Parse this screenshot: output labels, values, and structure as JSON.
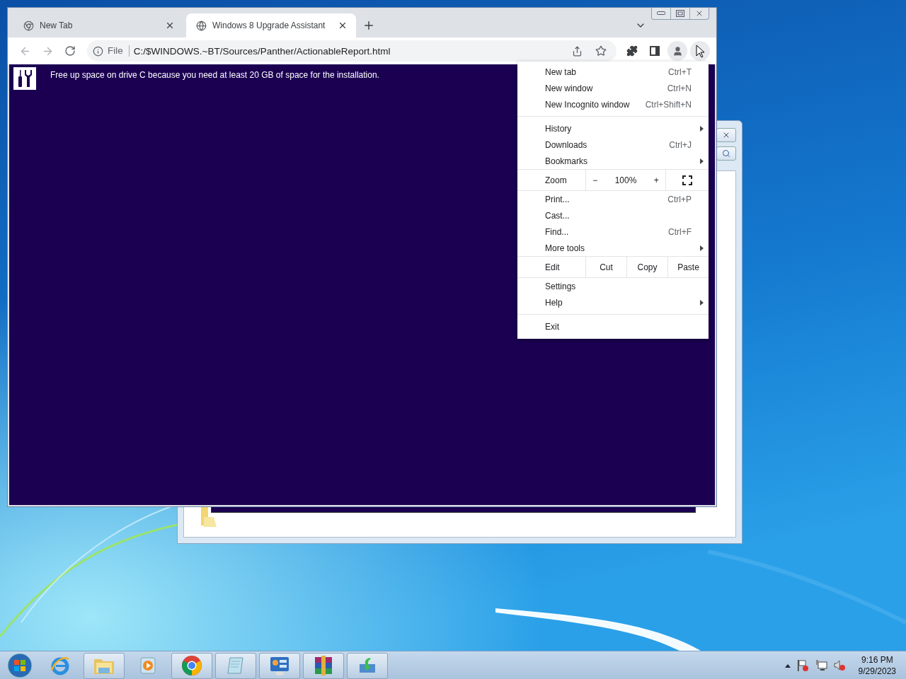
{
  "browser": {
    "tabs": [
      {
        "title": "New Tab",
        "kind": "chrome",
        "selected": false
      },
      {
        "title": "Windows 8 Upgrade Assistant",
        "kind": "globe",
        "selected": true
      }
    ],
    "address_bar": {
      "scheme": "File",
      "url": "C:/$WINDOWS.~BT/Sources/Panther/ActionableReport.html"
    },
    "page": {
      "message": "Free up space on drive C because you need at least 20 GB of space for the installation."
    },
    "menu": {
      "sections": [
        [
          {
            "kind": "item",
            "label": "New tab",
            "shortcut": "Ctrl+T",
            "submenu": false
          },
          {
            "kind": "item",
            "label": "New window",
            "shortcut": "Ctrl+N",
            "submenu": false
          },
          {
            "kind": "item",
            "label": "New Incognito window",
            "shortcut": "Ctrl+Shift+N",
            "submenu": false
          }
        ],
        [
          {
            "kind": "item",
            "label": "History",
            "submenu": true
          },
          {
            "kind": "item",
            "label": "Downloads",
            "shortcut": "Ctrl+J",
            "submenu": false
          },
          {
            "kind": "item",
            "label": "Bookmarks",
            "submenu": true
          }
        ],
        [
          {
            "kind": "zoom",
            "label": "Zoom",
            "minus": "−",
            "value": "100%",
            "plus": "+"
          }
        ],
        [
          {
            "kind": "item",
            "label": "Print...",
            "shortcut": "Ctrl+P",
            "submenu": false
          },
          {
            "kind": "item",
            "label": "Cast...",
            "submenu": false
          },
          {
            "kind": "item",
            "label": "Find...",
            "shortcut": "Ctrl+F",
            "submenu": false
          },
          {
            "kind": "item",
            "label": "More tools",
            "submenu": true
          }
        ],
        [
          {
            "kind": "edit",
            "label": "Edit",
            "actions": [
              "Cut",
              "Copy",
              "Paste"
            ]
          }
        ],
        [
          {
            "kind": "item",
            "label": "Settings",
            "submenu": false
          },
          {
            "kind": "item",
            "label": "Help",
            "submenu": true
          }
        ],
        [
          {
            "kind": "item",
            "label": "Exit",
            "submenu": false
          }
        ]
      ]
    }
  },
  "taskbar": {
    "apps": [
      {
        "kind": "ie",
        "running": false
      },
      {
        "kind": "folder",
        "running": true
      },
      {
        "kind": "media",
        "running": false
      },
      {
        "kind": "chrome",
        "running": true
      },
      {
        "kind": "notepad",
        "running": true
      },
      {
        "kind": "control",
        "running": true
      },
      {
        "kind": "archive",
        "running": true
      },
      {
        "kind": "install",
        "running": true
      }
    ],
    "clock": {
      "time": "9:16 PM",
      "date": "9/29/2023"
    }
  }
}
